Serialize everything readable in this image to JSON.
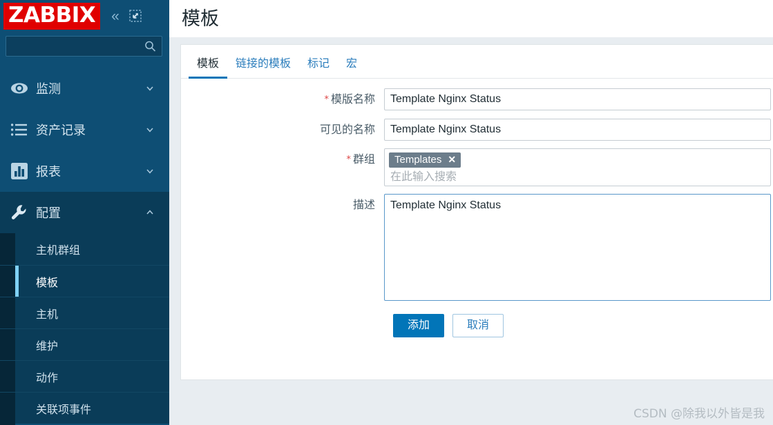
{
  "brand": {
    "logo_text": "ZABBIX",
    "logo_bg": "#e00000",
    "sidebar_bg": "#0e4e74",
    "accent": "#0275b8"
  },
  "sidebar": {
    "collapse_icon": "chevron-double-left-icon",
    "compact_icon": "compact-view-icon",
    "search": {
      "value": "",
      "placeholder": ""
    },
    "items": [
      {
        "label": "监测",
        "icon": "eye-icon",
        "expanded": false
      },
      {
        "label": "资产记录",
        "icon": "list-icon",
        "expanded": false
      },
      {
        "label": "报表",
        "icon": "bar-chart-icon",
        "expanded": false
      },
      {
        "label": "配置",
        "icon": "wrench-icon",
        "expanded": true
      }
    ],
    "submenu": [
      {
        "label": "主机群组",
        "active": false
      },
      {
        "label": "模板",
        "active": true
      },
      {
        "label": "主机",
        "active": false
      },
      {
        "label": "维护",
        "active": false
      },
      {
        "label": "动作",
        "active": false
      },
      {
        "label": "关联项事件",
        "active": false
      }
    ]
  },
  "header": {
    "title": "模板"
  },
  "tabs": [
    {
      "label": "模板",
      "active": true
    },
    {
      "label": "链接的模板",
      "active": false
    },
    {
      "label": "标记",
      "active": false
    },
    {
      "label": "宏",
      "active": false
    }
  ],
  "form": {
    "template_name": {
      "label": "模版名称",
      "required": true,
      "value": "Template Nginx Status"
    },
    "visible_name": {
      "label": "可见的名称",
      "required": false,
      "value": "Template Nginx Status"
    },
    "groups": {
      "label": "群组",
      "required": true,
      "chips": [
        {
          "text": "Templates",
          "remove_icon": "close-icon"
        }
      ],
      "placeholder": "在此输入搜索",
      "value": ""
    },
    "description": {
      "label": "描述",
      "required": false,
      "value": "Template Nginx Status"
    }
  },
  "buttons": {
    "submit": "添加",
    "cancel": "取消"
  },
  "watermark": {
    "text": "CSDN @除我以外皆是我"
  }
}
